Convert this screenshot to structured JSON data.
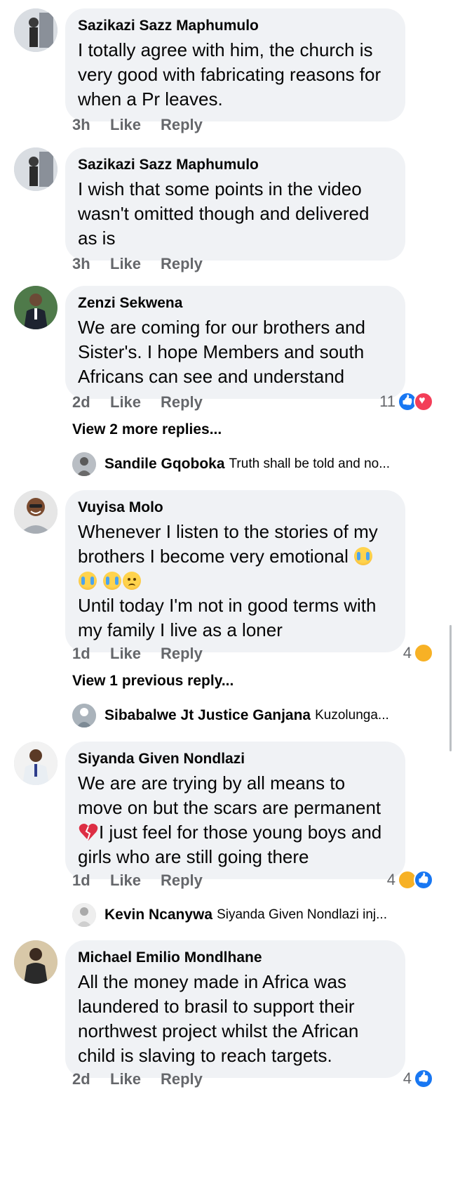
{
  "comments": [
    {
      "author": "Sazikazi Sazz Maphumulo",
      "text": "I totally agree with him, the church is very good with fabricating reasons for when a Pr leaves.",
      "time": "3h",
      "like": "Like",
      "reply": "Reply"
    },
    {
      "author": "Sazikazi Sazz Maphumulo",
      "text": "I wish that some points in the video wasn't omitted though and delivered as is",
      "time": "3h",
      "like": "Like",
      "reply": "Reply"
    },
    {
      "author": "Zenzi Sekwena",
      "text": "We are coming for our brothers and Sister's. I hope Members and south Africans can see and understand",
      "time": "2d",
      "like": "Like",
      "reply": "Reply",
      "reaction_count": "11",
      "reaction_icons": [
        "like",
        "love"
      ],
      "view_replies": "View 2 more replies...",
      "preview_reply": {
        "name": "Sandile Gqoboka",
        "snippet": "Truth shall be told and no..."
      }
    },
    {
      "author": "Vuyisa Molo",
      "text_line1": "Whenever I listen to the stories of my brothers I become very emotional",
      "text_line2": "Until today I'm not in good terms with my family I live as a loner",
      "time": "1d",
      "like": "Like",
      "reply": "Reply",
      "reaction_count": "4",
      "reaction_icons": [
        "sad"
      ],
      "view_replies": "View 1 previous reply...",
      "preview_reply": {
        "name": "Sibabalwe Jt Justice Ganjana",
        "snippet": "Kuzolunga..."
      }
    },
    {
      "author": "Siyanda Given Nondlazi",
      "text_before": "We are are trying by all means to move on but the scars are permanent",
      "text_after": "I just feel for those young boys and girls who are still going there",
      "time": "1d",
      "like": "Like",
      "reply": "Reply",
      "reaction_count": "4",
      "reaction_icons": [
        "sad",
        "like"
      ],
      "preview_reply": {
        "name": "Kevin Ncanywa",
        "snippet": "Siyanda Given Nondlazi inj..."
      }
    },
    {
      "author": "Michael Emilio Mondlhane",
      "text": "All the money made in Africa was laundered to brasil to support their northwest project whilst the African child is slaving to reach targets.",
      "time": "2d",
      "like": "Like",
      "reply": "Reply",
      "reaction_count": "4",
      "reaction_icons": [
        "like"
      ]
    }
  ]
}
